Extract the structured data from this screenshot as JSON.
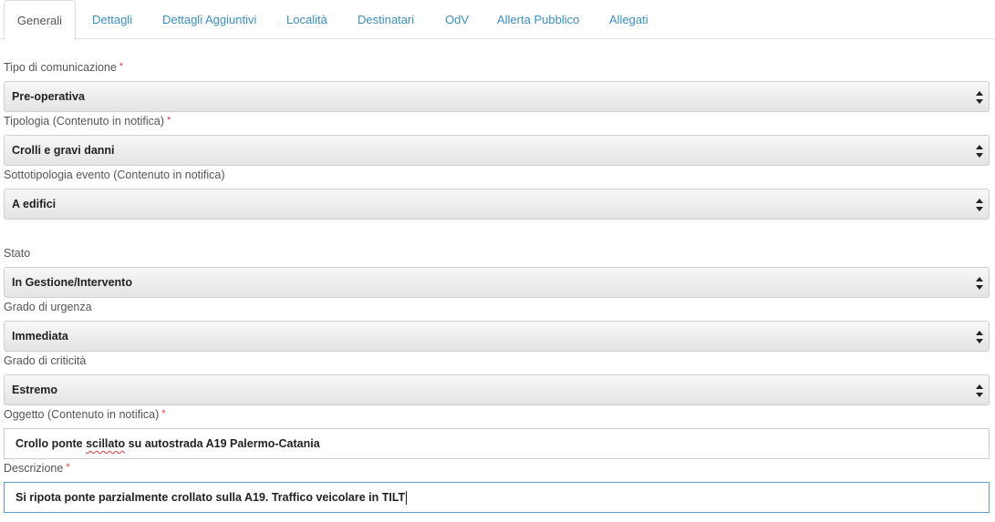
{
  "tabs": [
    {
      "label": "Generali",
      "active": true
    },
    {
      "label": "Dettagli"
    },
    {
      "label": "Dettagli Aggiuntivi"
    },
    {
      "label": "Località"
    },
    {
      "label": "Destinatari"
    },
    {
      "label": "OdV"
    },
    {
      "label": "Allerta Pubblico"
    },
    {
      "label": "Allegati"
    }
  ],
  "required_marker": "*",
  "form": {
    "tipo_comunicazione": {
      "label": "Tipo di comunicazione",
      "value": "Pre-operativa",
      "required": true
    },
    "tipologia": {
      "label": "Tipologia (Contenuto in notifica)",
      "value": "Crolli e gravi danni",
      "required": true
    },
    "sottotipologia": {
      "label": "Sottotipologia evento (Contenuto in notifica)",
      "value": "A edifici",
      "required": false
    },
    "stato": {
      "label": "Stato",
      "value": "In Gestione/Intervento",
      "required": false
    },
    "grado_urgenza": {
      "label": "Grado di urgenza",
      "value": "Immediata",
      "required": false
    },
    "grado_criticita": {
      "label": "Grado di criticità",
      "value": "Estremo",
      "required": false
    },
    "oggetto": {
      "label": "Oggetto (Contenuto in notifica)",
      "value_before": "Crollo ponte ",
      "value_misspelled": "scillato",
      "value_after": " su autostrada A19 Palermo-Catania",
      "required": true
    },
    "descrizione": {
      "label": "Descrizione",
      "value": "Si ripota ponte parzialmente crollato sulla A19. Traffico veicolare in TILT",
      "required": true
    }
  },
  "colors": {
    "tab_link": "#3a8fc6",
    "required": "#e03a3a",
    "focus_border": "#5aa0cf"
  }
}
